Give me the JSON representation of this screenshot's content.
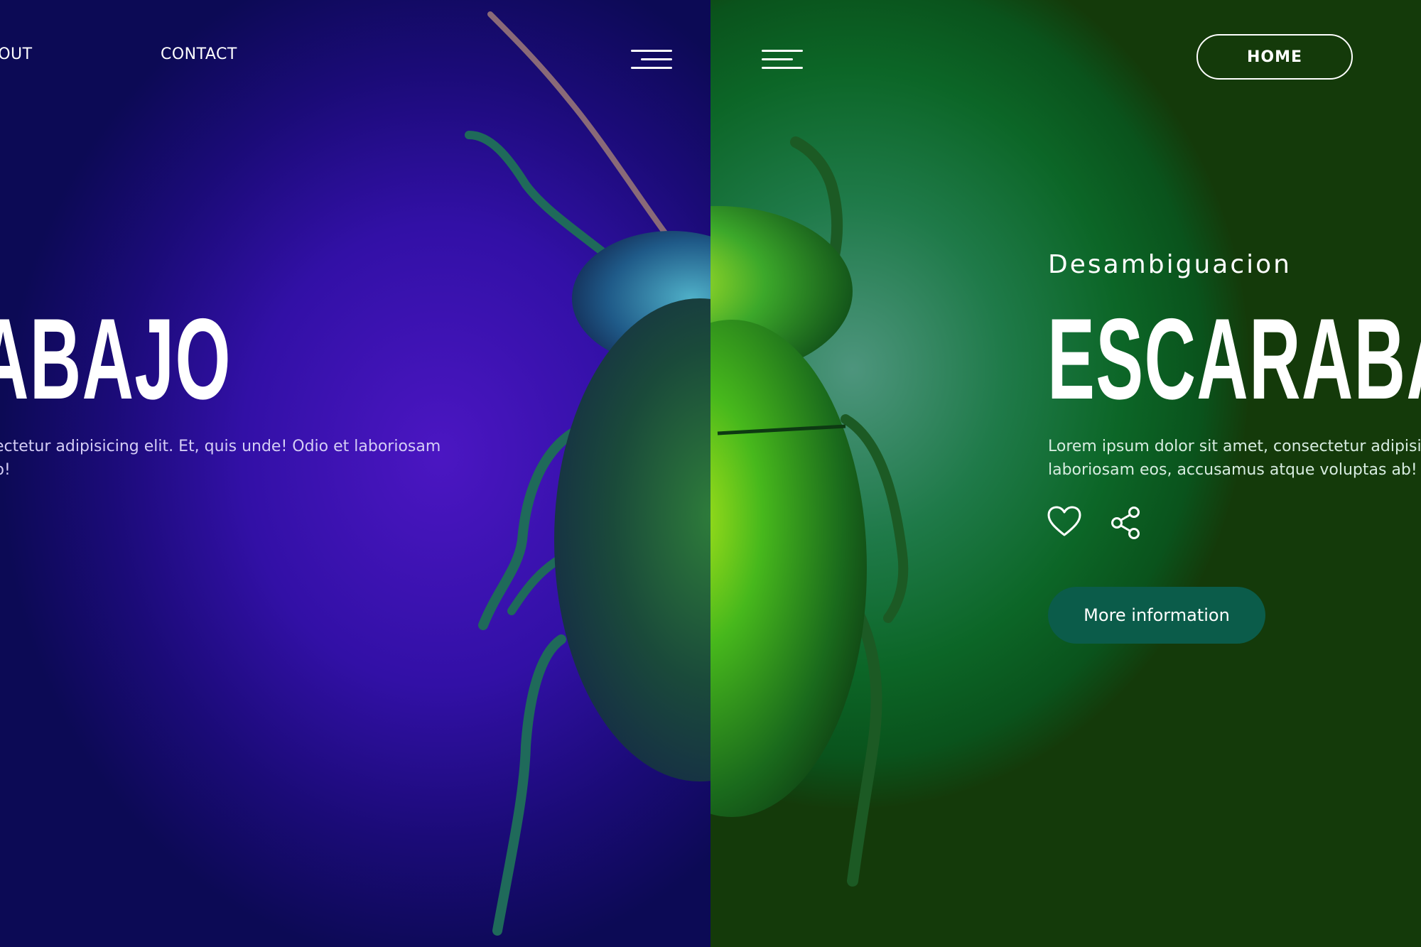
{
  "nav": {
    "about_label": "BOUT",
    "contact_label": "CONTACT",
    "home_label": "HOME"
  },
  "left": {
    "title": "ABAJO",
    "body_line1": "ectetur adipisicing elit. Et, quis unde! Odio et laboriosam",
    "body_line2": "b!"
  },
  "right": {
    "subtitle": "Desambiguacion",
    "title": "ESCARABA",
    "body_line1": "Lorem ipsum dolor sit amet, consectetur adipisicir",
    "body_line2": "laboriosam eos, accusamus atque voluptas ab!",
    "more_button_label": "More information"
  },
  "icons": {
    "menu": "hamburger-menu-icon",
    "heart": "heart-icon",
    "share": "share-icon"
  },
  "colors": {
    "left_bg": "#3a12b0",
    "right_bg": "#0c6627",
    "button_bg": "#0b5c4a",
    "text": "#ffffff"
  }
}
